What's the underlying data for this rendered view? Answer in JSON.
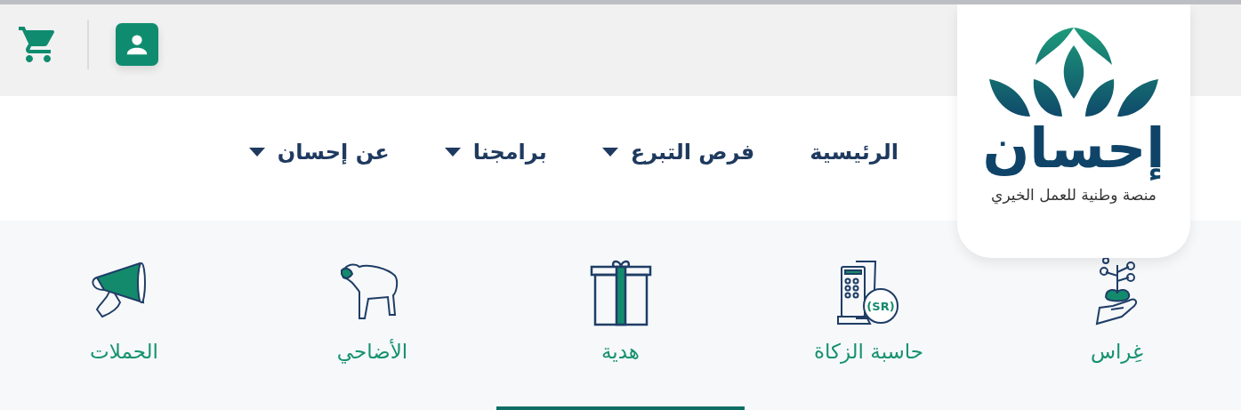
{
  "header": {
    "cart_button": {
      "kind": "cart"
    },
    "account_button": {
      "kind": "account"
    }
  },
  "logo": {
    "name": "إحسان",
    "tagline": "منصة وطنية للعمل الخيري"
  },
  "nav": [
    {
      "label": "الرئيسية",
      "has_menu": false
    },
    {
      "label": "فرص التبرع",
      "has_menu": true
    },
    {
      "label": "برامجنا",
      "has_menu": true
    },
    {
      "label": "عن إحسان",
      "has_menu": true
    }
  ],
  "categories": [
    {
      "kind": "plant",
      "label": "غِراس",
      "selected": false
    },
    {
      "kind": "calculator",
      "label": "حاسبة الزكاة",
      "badge": "(SR)",
      "selected": false
    },
    {
      "kind": "gift",
      "label": "هدية",
      "selected": true
    },
    {
      "kind": "sheep",
      "label": "الأضاحي",
      "selected": false
    },
    {
      "kind": "megaphone",
      "label": "الحملات",
      "selected": false
    }
  ]
}
